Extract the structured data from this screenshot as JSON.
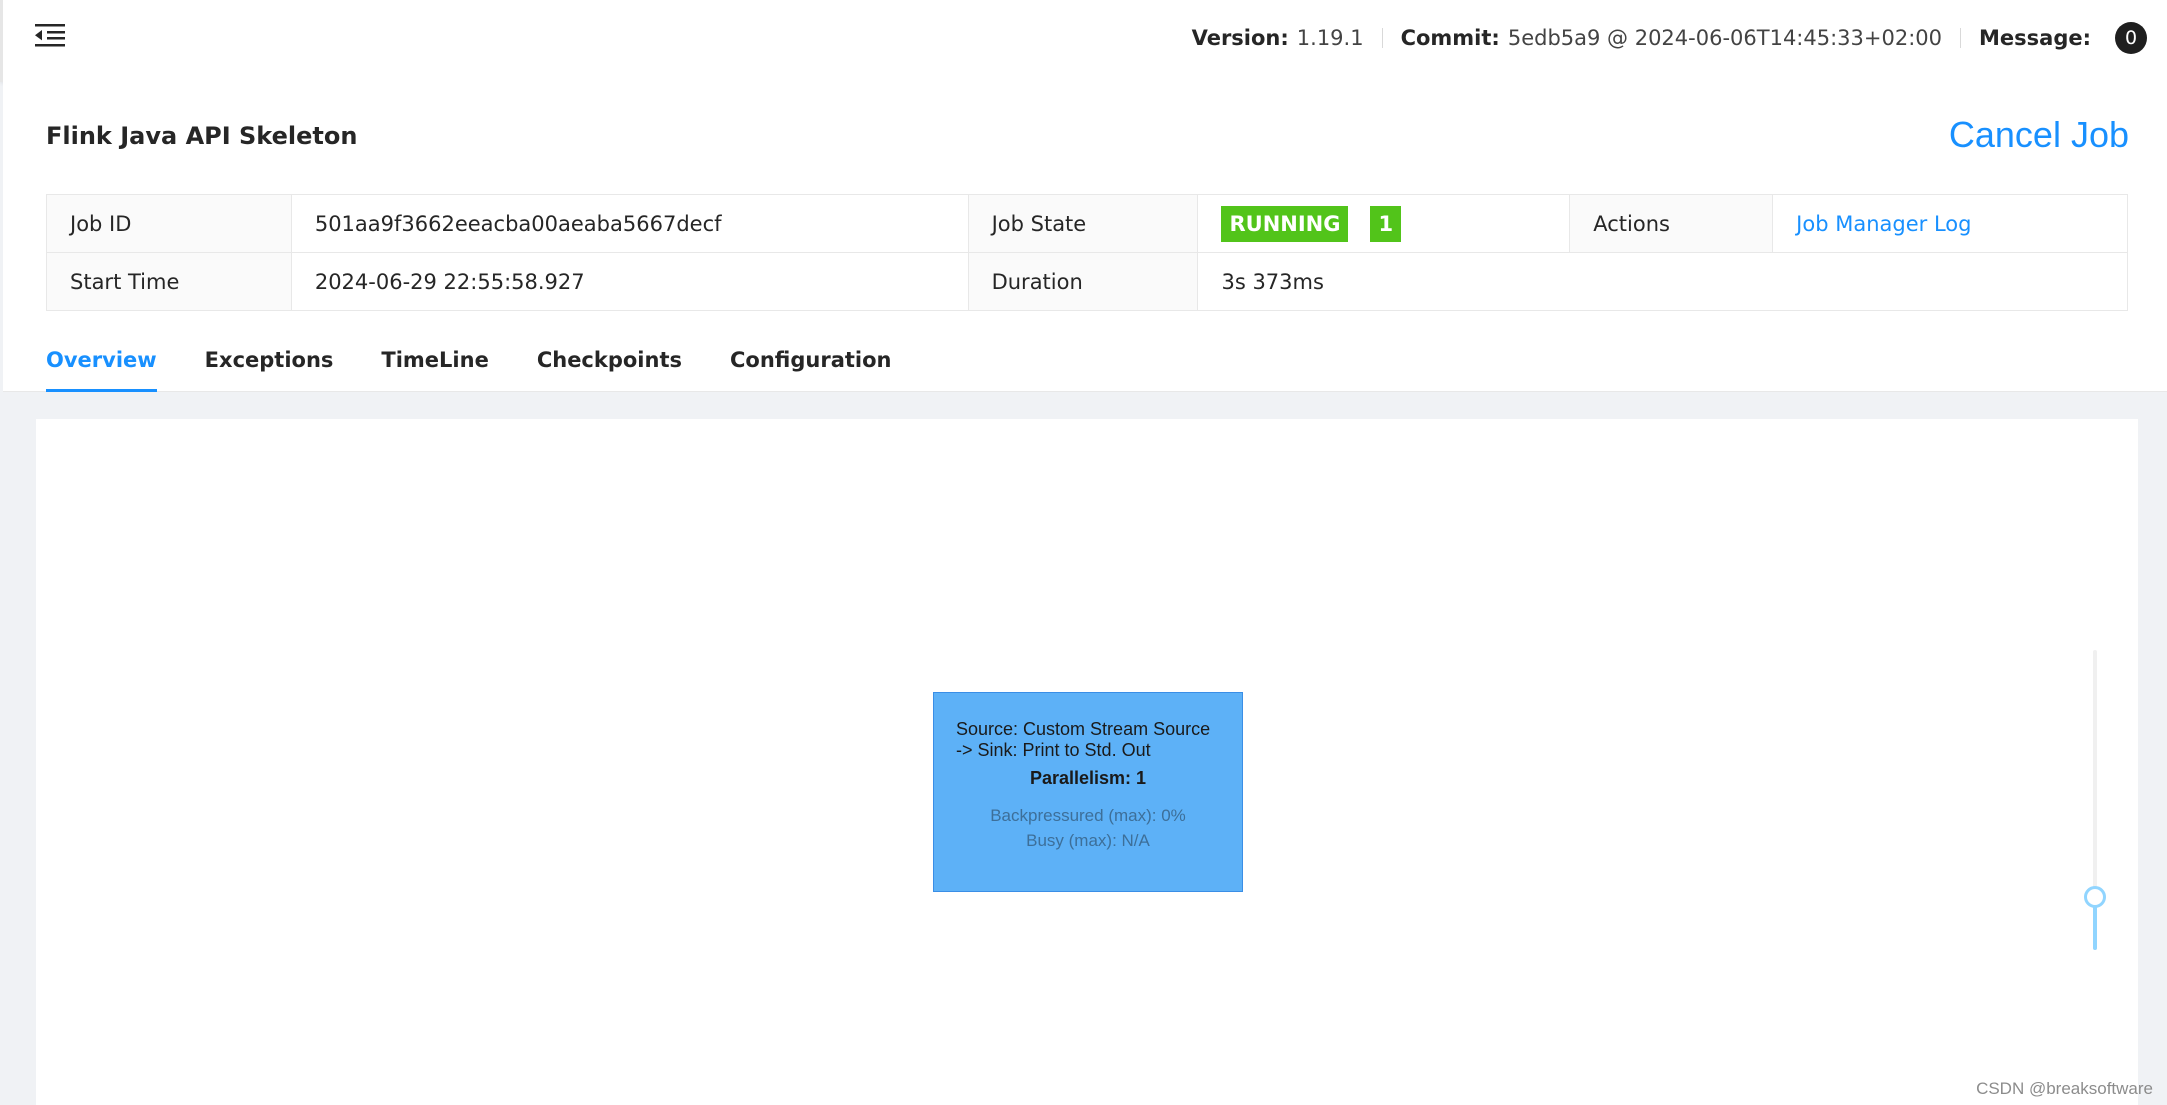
{
  "header": {
    "version_label": "Version:",
    "version_value": "1.19.1",
    "commit_label": "Commit:",
    "commit_value": "5edb5a9 @ 2024-06-06T14:45:33+02:00",
    "message_label": "Message:",
    "message_count": "0"
  },
  "job": {
    "title": "Flink Java API Skeleton",
    "cancel_label": "Cancel Job",
    "fields": {
      "job_id_label": "Job ID",
      "job_id_value": "501aa9f3662eeacba00aeaba5667decf",
      "job_state_label": "Job State",
      "job_state_value": "RUNNING",
      "job_state_count": "1",
      "actions_label": "Actions",
      "actions_link": "Job Manager Log",
      "start_time_label": "Start Time",
      "start_time_value": "2024-06-29 22:55:58.927",
      "duration_label": "Duration",
      "duration_value": "3s 373ms"
    }
  },
  "tabs": [
    {
      "label": "Overview",
      "active": true
    },
    {
      "label": "Exceptions",
      "active": false
    },
    {
      "label": "TimeLine",
      "active": false
    },
    {
      "label": "Checkpoints",
      "active": false
    },
    {
      "label": "Configuration",
      "active": false
    }
  ],
  "graph": {
    "node": {
      "name_line1": "Source: Custom Stream Source",
      "name_line2": "-> Sink: Print to Std. Out",
      "parallelism": "Parallelism: 1",
      "backpressured": "Backpressured (max): 0%",
      "busy": "Busy (max): N/A"
    }
  },
  "watermark": "CSDN @breaksoftware",
  "colors": {
    "accent": "#1890ff",
    "running": "#52c41a",
    "node": "#5db1f7"
  }
}
